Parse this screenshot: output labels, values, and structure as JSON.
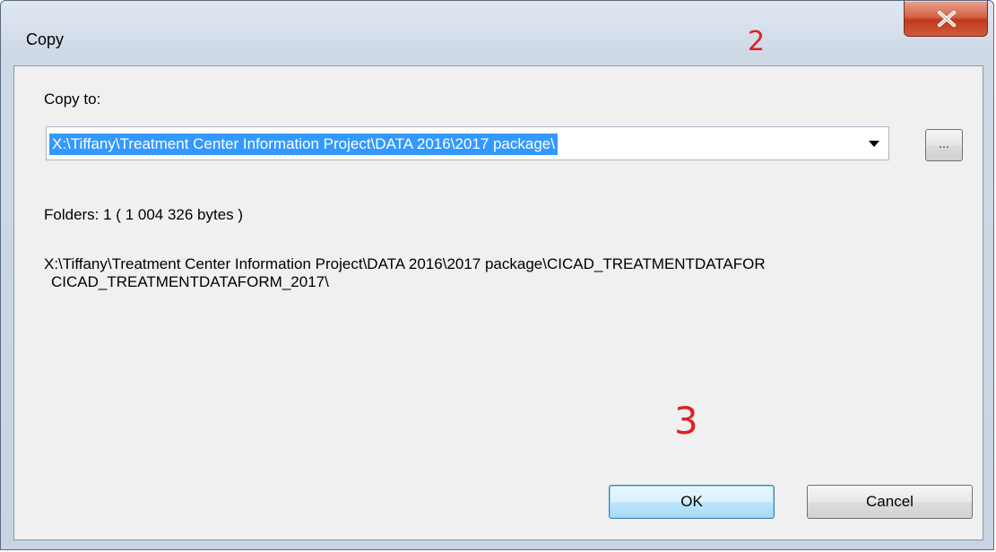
{
  "window": {
    "title": "Copy",
    "close_icon": "close-icon"
  },
  "annotations": {
    "marker_2": "2",
    "marker_3": "3",
    "color": "#e02020"
  },
  "form": {
    "copy_to_label": "Copy to:",
    "destination_value": "X:\\Tiffany\\Treatment Center Information Project\\DATA 2016\\2017 package\\",
    "browse_label": "...",
    "folders_summary": "Folders: 1    ( 1 004 326 bytes )",
    "source_path_line1": "X:\\Tiffany\\Treatment Center Information Project\\DATA 2016\\2017 package\\CICAD_TREATMENTDATAFOR",
    "source_path_line2": "CICAD_TREATMENTDATAFORM_2017\\"
  },
  "buttons": {
    "ok_label": "OK",
    "cancel_label": "Cancel"
  },
  "colors": {
    "selection_highlight": "#3399ff",
    "close_button": "#c03a1e",
    "dialog_background": "#f0f0f0"
  }
}
